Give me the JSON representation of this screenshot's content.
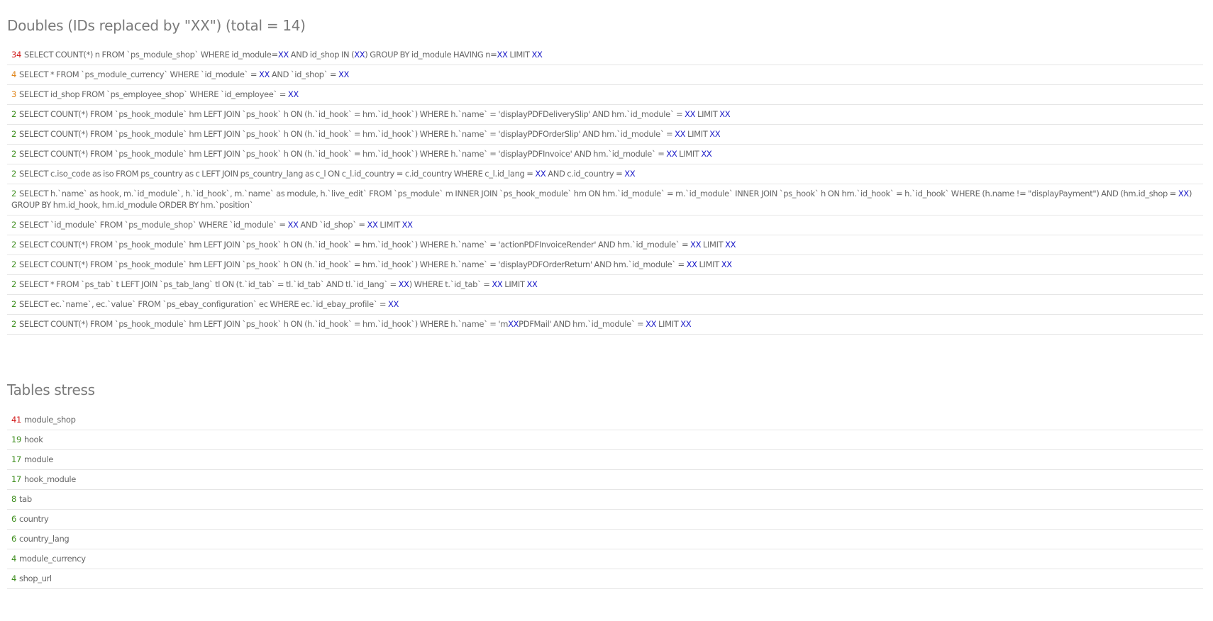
{
  "doubles": {
    "title": "Doubles (IDs replaced by \"XX\") (total = 14)",
    "rows": [
      {
        "count": "34",
        "level": "red",
        "query": [
          {
            "t": "SELECT COUNT(*) n FROM `ps_module_shop` WHERE id_module="
          },
          {
            "t": "XX",
            "x": true
          },
          {
            "t": " AND id_shop IN ("
          },
          {
            "t": "XX",
            "x": true
          },
          {
            "t": ") GROUP BY id_module HAVING n="
          },
          {
            "t": "XX",
            "x": true
          },
          {
            "t": " LIMIT "
          },
          {
            "t": "XX",
            "x": true
          }
        ]
      },
      {
        "count": "4",
        "level": "orange",
        "query": [
          {
            "t": "SELECT * FROM `ps_module_currency` WHERE `id_module` = "
          },
          {
            "t": "XX",
            "x": true
          },
          {
            "t": " AND `id_shop` = "
          },
          {
            "t": "XX",
            "x": true
          }
        ]
      },
      {
        "count": "3",
        "level": "orange",
        "query": [
          {
            "t": "SELECT id_shop FROM `ps_employee_shop` WHERE `id_employee` = "
          },
          {
            "t": "XX",
            "x": true
          }
        ]
      },
      {
        "count": "2",
        "level": "green",
        "query": [
          {
            "t": "SELECT COUNT(*) FROM `ps_hook_module` hm LEFT JOIN `ps_hook` h ON (h.`id_hook` = hm.`id_hook`) WHERE h.`name` = 'displayPDFDeliverySlip' AND hm.`id_module` = "
          },
          {
            "t": "XX",
            "x": true
          },
          {
            "t": " LIMIT "
          },
          {
            "t": "XX",
            "x": true
          }
        ]
      },
      {
        "count": "2",
        "level": "green",
        "query": [
          {
            "t": "SELECT COUNT(*) FROM `ps_hook_module` hm LEFT JOIN `ps_hook` h ON (h.`id_hook` = hm.`id_hook`) WHERE h.`name` = 'displayPDFOrderSlip' AND hm.`id_module` = "
          },
          {
            "t": "XX",
            "x": true
          },
          {
            "t": " LIMIT "
          },
          {
            "t": "XX",
            "x": true
          }
        ]
      },
      {
        "count": "2",
        "level": "green",
        "query": [
          {
            "t": "SELECT COUNT(*) FROM `ps_hook_module` hm LEFT JOIN `ps_hook` h ON (h.`id_hook` = hm.`id_hook`) WHERE h.`name` = 'displayPDFInvoice' AND hm.`id_module` = "
          },
          {
            "t": "XX",
            "x": true
          },
          {
            "t": " LIMIT "
          },
          {
            "t": "XX",
            "x": true
          }
        ]
      },
      {
        "count": "2",
        "level": "green",
        "query": [
          {
            "t": "SELECT c.iso_code as iso FROM ps_country as c LEFT JOIN ps_country_lang as c_l ON c_l.id_country = c.id_country WHERE c_l.id_lang = "
          },
          {
            "t": "XX",
            "x": true
          },
          {
            "t": " AND c.id_country = "
          },
          {
            "t": "XX",
            "x": true
          }
        ]
      },
      {
        "count": "2",
        "level": "green",
        "query": [
          {
            "t": "SELECT h.`name` as hook, m.`id_module`, h.`id_hook`, m.`name` as module, h.`live_edit` FROM `ps_module` m INNER JOIN `ps_hook_module` hm ON hm.`id_module` = m.`id_module` INNER JOIN `ps_hook` h ON hm.`id_hook` = h.`id_hook` WHERE (h.name != \"displayPayment\") AND (hm.id_shop = "
          },
          {
            "t": "XX",
            "x": true
          },
          {
            "t": ") GROUP BY hm.id_hook, hm.id_module ORDER BY hm.`position`"
          }
        ]
      },
      {
        "count": "2",
        "level": "green",
        "query": [
          {
            "t": "SELECT `id_module` FROM `ps_module_shop` WHERE `id_module` = "
          },
          {
            "t": "XX",
            "x": true
          },
          {
            "t": " AND `id_shop` = "
          },
          {
            "t": "XX",
            "x": true
          },
          {
            "t": " LIMIT "
          },
          {
            "t": "XX",
            "x": true
          }
        ]
      },
      {
        "count": "2",
        "level": "green",
        "query": [
          {
            "t": "SELECT COUNT(*) FROM `ps_hook_module` hm LEFT JOIN `ps_hook` h ON (h.`id_hook` = hm.`id_hook`) WHERE h.`name` = 'actionPDFInvoiceRender' AND hm.`id_module` = "
          },
          {
            "t": "XX",
            "x": true
          },
          {
            "t": " LIMIT "
          },
          {
            "t": "XX",
            "x": true
          }
        ]
      },
      {
        "count": "2",
        "level": "green",
        "query": [
          {
            "t": "SELECT COUNT(*) FROM `ps_hook_module` hm LEFT JOIN `ps_hook` h ON (h.`id_hook` = hm.`id_hook`) WHERE h.`name` = 'displayPDFOrderReturn' AND hm.`id_module` = "
          },
          {
            "t": "XX",
            "x": true
          },
          {
            "t": " LIMIT "
          },
          {
            "t": "XX",
            "x": true
          }
        ]
      },
      {
        "count": "2",
        "level": "green",
        "query": [
          {
            "t": "SELECT * FROM `ps_tab` t LEFT JOIN `ps_tab_lang` tl ON (t.`id_tab` = tl.`id_tab` AND tl.`id_lang` = "
          },
          {
            "t": "XX",
            "x": true
          },
          {
            "t": ") WHERE t.`id_tab` = "
          },
          {
            "t": "XX",
            "x": true
          },
          {
            "t": " LIMIT "
          },
          {
            "t": "XX",
            "x": true
          }
        ]
      },
      {
        "count": "2",
        "level": "green",
        "query": [
          {
            "t": "SELECT ec.`name`, ec.`value` FROM `ps_ebay_configuration` ec WHERE ec.`id_ebay_profile` = "
          },
          {
            "t": "XX",
            "x": true
          }
        ]
      },
      {
        "count": "2",
        "level": "green",
        "query": [
          {
            "t": "SELECT COUNT(*) FROM `ps_hook_module` hm LEFT JOIN `ps_hook` h ON (h.`id_hook` = hm.`id_hook`) WHERE h.`name` = 'm"
          },
          {
            "t": "XX",
            "x": true
          },
          {
            "t": "PDFMail' AND hm.`id_module` = "
          },
          {
            "t": "XX",
            "x": true
          },
          {
            "t": " LIMIT "
          },
          {
            "t": "XX",
            "x": true
          }
        ]
      }
    ]
  },
  "stress": {
    "title": "Tables stress",
    "rows": [
      {
        "count": "41",
        "level": "red",
        "name": "module_shop"
      },
      {
        "count": "19",
        "level": "green",
        "name": "hook"
      },
      {
        "count": "17",
        "level": "green",
        "name": "module"
      },
      {
        "count": "17",
        "level": "green",
        "name": "hook_module"
      },
      {
        "count": "8",
        "level": "green",
        "name": "tab"
      },
      {
        "count": "6",
        "level": "green",
        "name": "country"
      },
      {
        "count": "6",
        "level": "green",
        "name": "country_lang"
      },
      {
        "count": "4",
        "level": "green",
        "name": "module_currency"
      },
      {
        "count": "4",
        "level": "green",
        "name": "shop_url"
      }
    ]
  },
  "colors": {
    "red": "#d21a1a",
    "orange": "#e0851a",
    "green": "#3f8f1f",
    "placeholder": "#1a1ac8",
    "text": "#666666"
  }
}
